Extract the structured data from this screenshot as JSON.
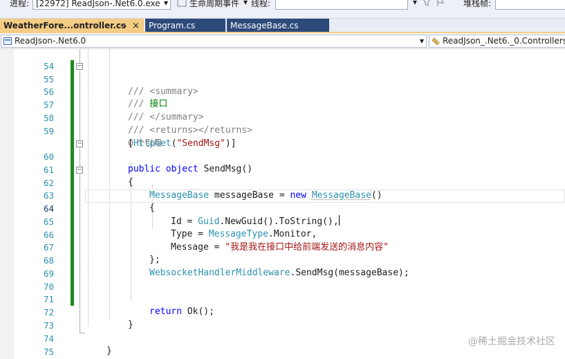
{
  "toolbar": {
    "process_label": "进程:",
    "process_value": "[22972] ReadJson-.Net6.0.exe",
    "lifecycle_label": "生命周期事件",
    "thread_label": "线程:",
    "stackframe_label": "堆栈帧:"
  },
  "tabs": [
    {
      "label": "WeatherFore...ontroller.cs",
      "active": true
    },
    {
      "label": "Program.cs",
      "active": false
    },
    {
      "label": "MessageBase.cs",
      "active": false
    }
  ],
  "tab_pin_glyph": "⊸",
  "tab_close_glyph": "×",
  "navbar": {
    "project": "ReadJson-.Net6.0",
    "class": "ReadJson_.Net6._0.Controllers.W"
  },
  "code": {
    "line_numbers": [
      "54",
      "55",
      "56",
      "57",
      "58",
      "59",
      "",
      "60",
      "61",
      "62",
      "63",
      "64",
      "65",
      "66",
      "67",
      "68",
      "69",
      "70",
      "71",
      "72",
      "73",
      "74",
      "75"
    ],
    "summary_open": "/// <summary>",
    "summary_text_prefix": "/// ",
    "summary_text": "接口",
    "summary_close": "/// </summary>",
    "returns": "/// <returns></returns>",
    "attr_open": "[",
    "attr_name": "HttpGet",
    "attr_paren": "(",
    "attr_str": "\"SendMsg\"",
    "attr_close": ")]",
    "references": "0 个引用",
    "kw_public": "public",
    "kw_object": "object",
    "method_sig": " SendMsg()",
    "brace_open": "{",
    "brace_close": "}",
    "decl_type": "MessageBase",
    "decl_var": " messageBase = ",
    "kw_new": "new",
    "decl_ctor": "MessageBase",
    "decl_end": "()",
    "id_prefix": "Id = ",
    "id_type": "Guid",
    "id_suffix": ".NewGuid().ToString(),",
    "type_prefix": "Type = ",
    "type_enum": "MessageType",
    "type_suffix": ".Monitor,",
    "msg_prefix": "Message = ",
    "msg_str": "\"我是我在接口中给前端发送的消息内容\"",
    "init_close": "};",
    "call_type": "WebsocketHandlerMiddleware",
    "call_rest": ".SendMsg(messageBase);",
    "kw_return": "return",
    "return_rest": " Ok();"
  },
  "watermark": "@稀土掘金技术社区",
  "colors": {
    "active_tab": "#f5cc84",
    "inactive_tab": "#2d4a7a",
    "change_bar": "#1e8a1e",
    "keyword": "#0000ff",
    "type": "#2b91af",
    "comment": "#008000",
    "string": "#a31515"
  }
}
